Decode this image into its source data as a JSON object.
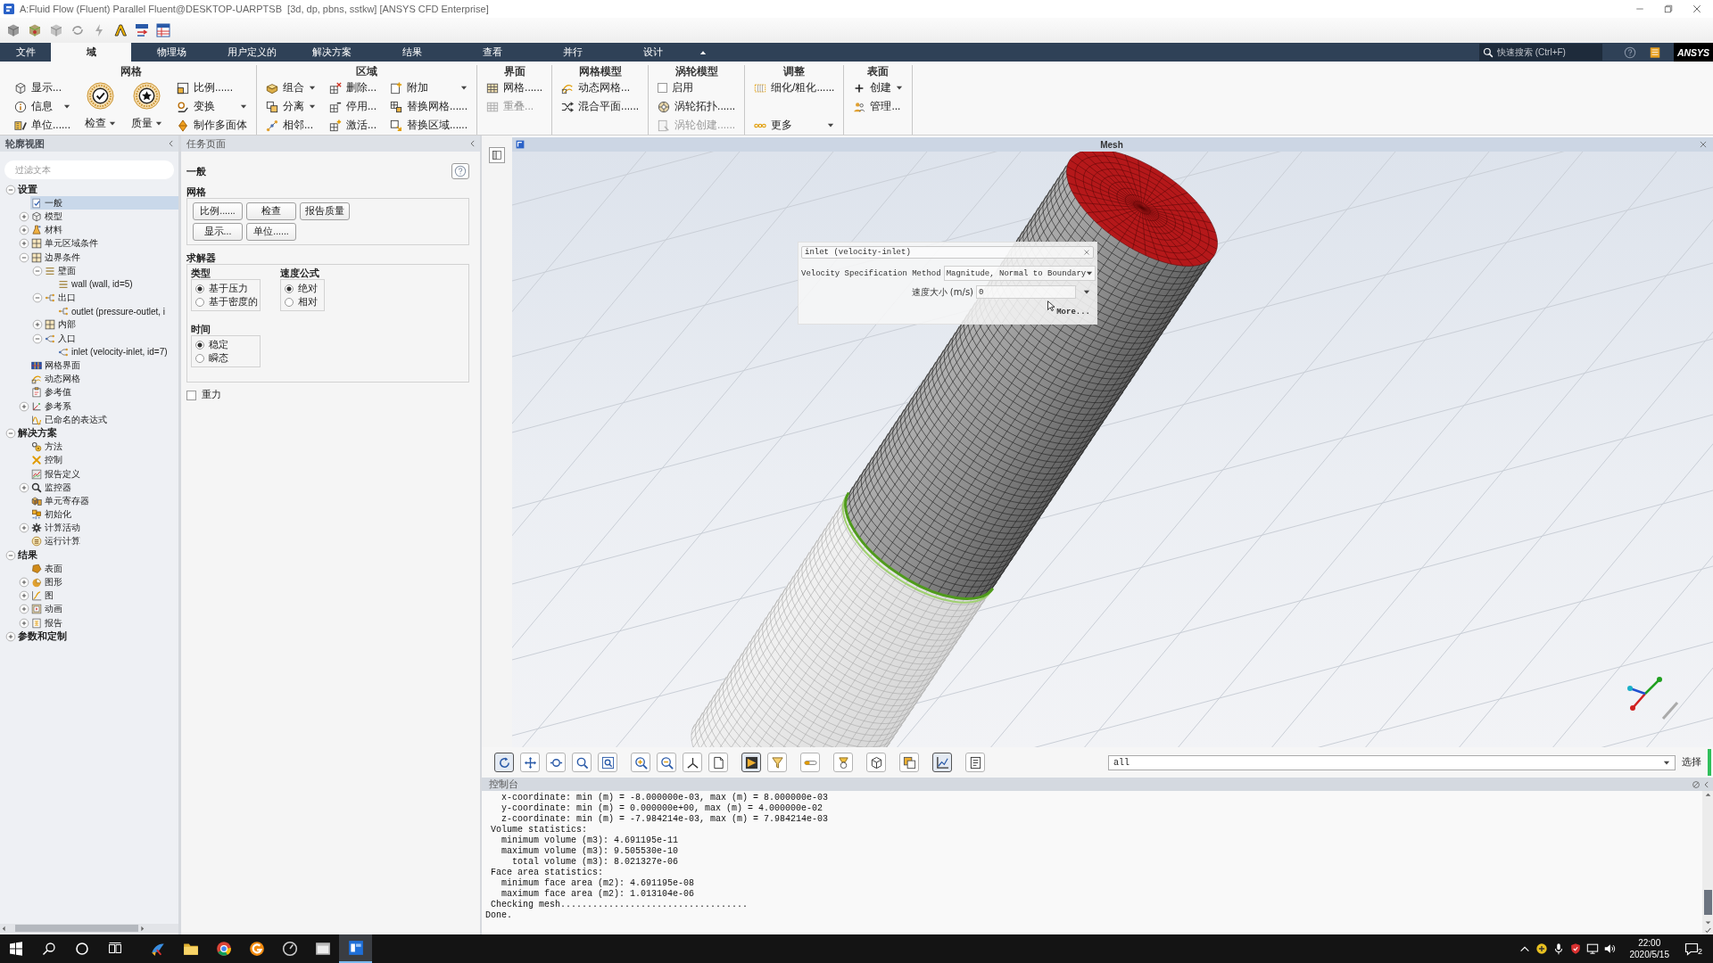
{
  "title_bar": {
    "title": "A:Fluid Flow (Fluent) Parallel Fluent@DESKTOP-UARPTSB  [3d, dp, pbns, sstkw] [ANSYS CFD Enterprise]"
  },
  "ribbon": {
    "tabs": [
      {
        "label": "文件",
        "selected": false
      },
      {
        "label": "域",
        "selected": true
      },
      {
        "label": "物理场",
        "selected": false
      },
      {
        "label": "用户定义的",
        "selected": false
      },
      {
        "label": "解决方案",
        "selected": false
      },
      {
        "label": "结果",
        "selected": false
      },
      {
        "label": "查看",
        "selected": false
      },
      {
        "label": "并行",
        "selected": false
      },
      {
        "label": "设计",
        "selected": false
      }
    ],
    "search": {
      "placeholder": "快速搜索 (Ctrl+F)"
    },
    "logo": "ANSYS",
    "groups": [
      {
        "title": "网格",
        "columns": [
          [
            {
              "kind": "button",
              "label": "显示...",
              "menu": false,
              "disabled": false
            },
            {
              "kind": "button",
              "label": "信息",
              "menu": true,
              "disabled": false
            },
            {
              "kind": "button",
              "label": "单位......",
              "menu": false,
              "disabled": false
            }
          ],
          [
            {
              "kind": "large",
              "label": "检查",
              "menu": true,
              "disabled": false
            }
          ],
          [
            {
              "kind": "large",
              "label": "质量",
              "menu": true,
              "disabled": false
            }
          ],
          [
            {
              "kind": "button",
              "label": "比例......",
              "menu": false,
              "disabled": false
            },
            {
              "kind": "button",
              "label": "变换",
              "menu": true,
              "disabled": false
            },
            {
              "kind": "button",
              "label": "制作多面体",
              "menu": false,
              "disabled": false
            }
          ]
        ]
      },
      {
        "title": "区域",
        "columns": [
          [
            {
              "kind": "button",
              "label": "组合",
              "menu": true,
              "disabled": false
            },
            {
              "kind": "button",
              "label": "分离",
              "menu": true,
              "disabled": false
            },
            {
              "kind": "button",
              "label": "相邻...",
              "menu": false,
              "disabled": false
            }
          ],
          [
            {
              "kind": "button",
              "label": "删除...",
              "menu": false,
              "disabled": false
            },
            {
              "kind": "button",
              "label": "停用...",
              "menu": false,
              "disabled": false
            },
            {
              "kind": "button",
              "label": "激活...",
              "menu": false,
              "disabled": false
            }
          ],
          [
            {
              "kind": "button",
              "label": "附加",
              "menu": true,
              "disabled": false
            },
            {
              "kind": "button",
              "label": "替换网格......",
              "menu": false,
              "disabled": false
            },
            {
              "kind": "button",
              "label": "替换区域......",
              "menu": false,
              "disabled": false
            }
          ]
        ]
      },
      {
        "title": "界面",
        "columns": [
          [
            {
              "kind": "button",
              "label": "网格......",
              "menu": false,
              "disabled": false
            },
            {
              "kind": "button",
              "label": "重叠...",
              "menu": false,
              "disabled": true
            }
          ]
        ]
      },
      {
        "title": "网格模型",
        "columns": [
          [
            {
              "kind": "button",
              "label": "动态网格...",
              "menu": false,
              "disabled": false
            },
            {
              "kind": "button",
              "label": "混合平面......",
              "menu": false,
              "disabled": false
            }
          ]
        ]
      },
      {
        "title": "涡轮模型",
        "columns": [
          [
            {
              "kind": "check",
              "label": "启用",
              "checked": false,
              "disabled": false
            },
            {
              "kind": "button",
              "label": "涡轮拓扑......",
              "menu": false,
              "disabled": false
            },
            {
              "kind": "button",
              "label": "涡轮创建......",
              "menu": false,
              "disabled": true
            }
          ]
        ]
      },
      {
        "title": "调整",
        "columns": [
          [
            {
              "kind": "button",
              "label": "细化/粗化......",
              "menu": false,
              "disabled": false
            },
            {
              "kind": "overflow",
              "label": "更多",
              "menu": true,
              "disabled": false
            }
          ]
        ]
      },
      {
        "title": "表面",
        "columns": [
          [
            {
              "kind": "button",
              "label": "创建",
              "menu": true,
              "disabled": false
            },
            {
              "kind": "button",
              "label": "管理...",
              "menu": false,
              "disabled": false
            }
          ]
        ]
      }
    ]
  },
  "outline": {
    "title": "轮廓视图",
    "filter": {
      "placeholder": "过滤文本"
    },
    "tree": [
      {
        "label": "设置",
        "kind": "section",
        "selected": false,
        "expanded": true,
        "children": [
          {
            "label": "一般",
            "kind": "general",
            "selected": true
          },
          {
            "label": "模型",
            "kind": "models",
            "selected": false,
            "expanded": false
          },
          {
            "label": "材料",
            "kind": "materials",
            "selected": false,
            "expanded": false
          },
          {
            "label": "单元区域条件",
            "kind": "zones",
            "selected": false,
            "expanded": false
          },
          {
            "label": "边界条件",
            "kind": "zones",
            "selected": false,
            "expanded": true,
            "children": [
              {
                "label": "壁面",
                "kind": "wall",
                "selected": false,
                "expanded": true,
                "children": [
                  {
                    "label": "wall (wall, id=5)",
                    "kind": "wall",
                    "selected": false
                  }
                ]
              },
              {
                "label": "出口",
                "kind": "outlet",
                "selected": false,
                "expanded": true,
                "children": [
                  {
                    "label": "outlet (pressure-outlet, i",
                    "kind": "outlet",
                    "selected": false
                  }
                ]
              },
              {
                "label": "内部",
                "kind": "zones",
                "selected": false,
                "expanded": false
              },
              {
                "label": "入口",
                "kind": "inlet",
                "selected": false,
                "expanded": true,
                "children": [
                  {
                    "label": "inlet (velocity-inlet, id=7)",
                    "kind": "inlet",
                    "selected": false
                  }
                ]
              }
            ]
          },
          {
            "label": "网格界面",
            "kind": "interfaces",
            "selected": false
          },
          {
            "label": "动态网格",
            "kind": "dynamic",
            "selected": false
          },
          {
            "label": "参考值",
            "kind": "reference",
            "selected": false
          },
          {
            "label": "参考系",
            "kind": "frames",
            "selected": false,
            "expanded": false
          },
          {
            "label": "已命名的表达式",
            "kind": "expressions",
            "selected": false
          }
        ]
      },
      {
        "label": "解决方案",
        "kind": "section",
        "selected": false,
        "expanded": true,
        "children": [
          {
            "label": "方法",
            "kind": "methods",
            "selected": false
          },
          {
            "label": "控制",
            "kind": "controls",
            "selected": false
          },
          {
            "label": "报告定义",
            "kind": "definitions",
            "selected": false
          },
          {
            "label": "监控器",
            "kind": "monitors",
            "selected": false,
            "expanded": false
          },
          {
            "label": "单元寄存器",
            "kind": "registers",
            "selected": false
          },
          {
            "label": "初始化",
            "kind": "initialization",
            "selected": false
          },
          {
            "label": "计算活动",
            "kind": "activities",
            "selected": false,
            "expanded": false
          },
          {
            "label": "运行计算",
            "kind": "run",
            "selected": false
          }
        ]
      },
      {
        "label": "结果",
        "kind": "section",
        "selected": false,
        "expanded": true,
        "children": [
          {
            "label": "表面",
            "kind": "surfaces",
            "selected": false
          },
          {
            "label": "图形",
            "kind": "graphics",
            "selected": false,
            "expanded": false
          },
          {
            "label": "图",
            "kind": "plots",
            "selected": false,
            "expanded": false
          },
          {
            "label": "动画",
            "kind": "animations",
            "selected": false,
            "expanded": false
          },
          {
            "label": "报告",
            "kind": "reports",
            "selected": false,
            "expanded": false
          }
        ]
      },
      {
        "label": "参数和定制",
        "kind": "section",
        "selected": false,
        "expanded": false
      }
    ]
  },
  "task_page": {
    "title": "任务页面",
    "heading": "一般",
    "mesh": {
      "title": "网格",
      "buttons": [
        "比例......",
        "检查",
        "报告质量",
        "显示...",
        "单位......"
      ]
    },
    "solver": {
      "title": "求解器",
      "groups": [
        {
          "title": "类型",
          "options": [
            {
              "label": "基于压力",
              "selected": true
            },
            {
              "label": "基于密度的",
              "selected": false
            }
          ]
        },
        {
          "title": "速度公式",
          "options": [
            {
              "label": "绝对",
              "selected": true
            },
            {
              "label": "相对",
              "selected": false
            }
          ]
        },
        {
          "title": "时间",
          "options": [
            {
              "label": "稳定",
              "selected": true
            },
            {
              "label": "瞬态",
              "selected": false
            }
          ]
        }
      ]
    },
    "gravity": {
      "label": "重力",
      "checked": false
    }
  },
  "viewport": {
    "title": "Mesh",
    "dialog": {
      "title": "inlet (velocity-inlet)",
      "method": {
        "label": "Velocity Specification Method",
        "value": "Magnitude, Normal to Boundary"
      },
      "speed": {
        "label": "速度大小 (m/s)",
        "value": "0"
      },
      "more_button": "More..."
    },
    "toolbar": {
      "buttons": [
        {
          "selected": true
        },
        {
          "selected": false
        },
        {
          "selected": false
        },
        {
          "selected": false
        },
        {
          "selected": false
        },
        {
          "selected": false
        },
        {
          "selected": false
        },
        {
          "selected": false
        },
        {
          "selected": false
        },
        {
          "selected": true
        },
        {
          "selected": false
        },
        {
          "selected": false
        },
        {
          "selected": false
        },
        {
          "selected": false
        },
        {
          "selected": false
        },
        {
          "selected": true
        },
        {
          "selected": false
        }
      ],
      "surface_filter": {
        "value": "all"
      },
      "select_label": "选择"
    }
  },
  "console": {
    "title": "控制台",
    "lines": [
      "   x-coordinate: min (m) = -8.000000e-03, max (m) = 8.000000e-03",
      "   y-coordinate: min (m) = 0.000000e+00, max (m) = 4.000000e-02",
      "   z-coordinate: min (m) = -7.984214e-03, max (m) = 7.984214e-03",
      " Volume statistics:",
      "   minimum volume (m3): 4.691195e-11",
      "   maximum volume (m3): 9.505530e-10",
      "     total volume (m3): 8.021327e-06",
      " Face area statistics:",
      "   minimum face area (m2): 4.691195e-08",
      "   maximum face area (m2): 1.013104e-06",
      " Checking mesh...................................",
      "Done."
    ]
  },
  "taskbar": {
    "apps": [
      {
        "selected": false
      },
      {
        "selected": false
      },
      {
        "selected": false
      },
      {
        "selected": false
      },
      {
        "selected": false
      },
      {
        "selected": false
      },
      {
        "selected": true
      }
    ],
    "clock": {
      "time": "22:00",
      "date": "2020/5/15"
    },
    "notification_count": "2"
  }
}
